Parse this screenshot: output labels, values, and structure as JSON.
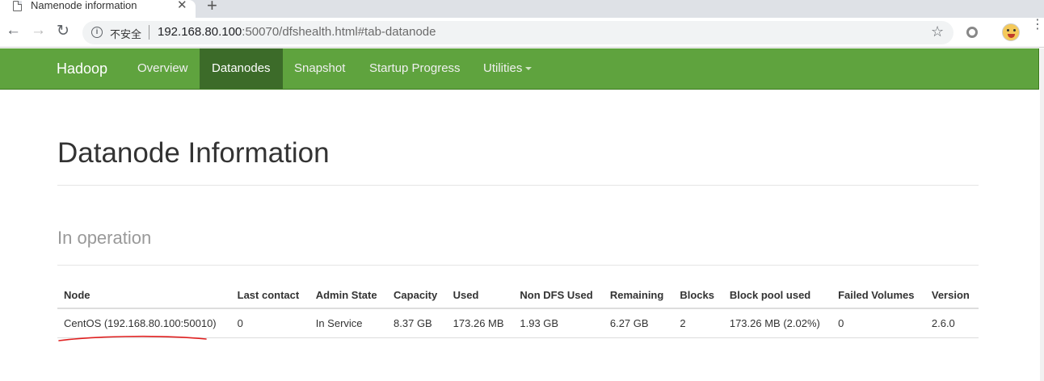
{
  "browser": {
    "tab_title": "Namenode information",
    "tab_close_glyph": "✕",
    "new_tab_glyph": "+",
    "back_glyph": "←",
    "forward_glyph": "→",
    "reload_glyph": "↻",
    "security_label": "不安全",
    "url_host": "192.168.80.100",
    "url_rest": ":50070/dfshealth.html#tab-datanode",
    "bookmark_glyph": "☆",
    "menu_glyph": "⋮"
  },
  "navbar": {
    "brand": "Hadoop",
    "items": [
      {
        "label": "Overview",
        "active": false
      },
      {
        "label": "Datanodes",
        "active": true
      },
      {
        "label": "Snapshot",
        "active": false
      },
      {
        "label": "Startup Progress",
        "active": false
      },
      {
        "label": "Utilities",
        "active": false,
        "dropdown": true
      }
    ],
    "colors": {
      "background": "#5fa33e",
      "active": "#3c6b29"
    }
  },
  "page": {
    "title": "Datanode Information",
    "section_title": "In operation"
  },
  "table": {
    "headers": [
      "Node",
      "Last contact",
      "Admin State",
      "Capacity",
      "Used",
      "Non DFS Used",
      "Remaining",
      "Blocks",
      "Block pool used",
      "Failed Volumes",
      "Version"
    ],
    "rows": [
      [
        "CentOS (192.168.80.100:50010)",
        "0",
        "In Service",
        "8.37 GB",
        "173.26 MB",
        "1.93 GB",
        "6.27 GB",
        "2",
        "173.26 MB (2.02%)",
        "0",
        "2.6.0"
      ]
    ]
  },
  "annotation": {
    "color": "#e02020"
  }
}
